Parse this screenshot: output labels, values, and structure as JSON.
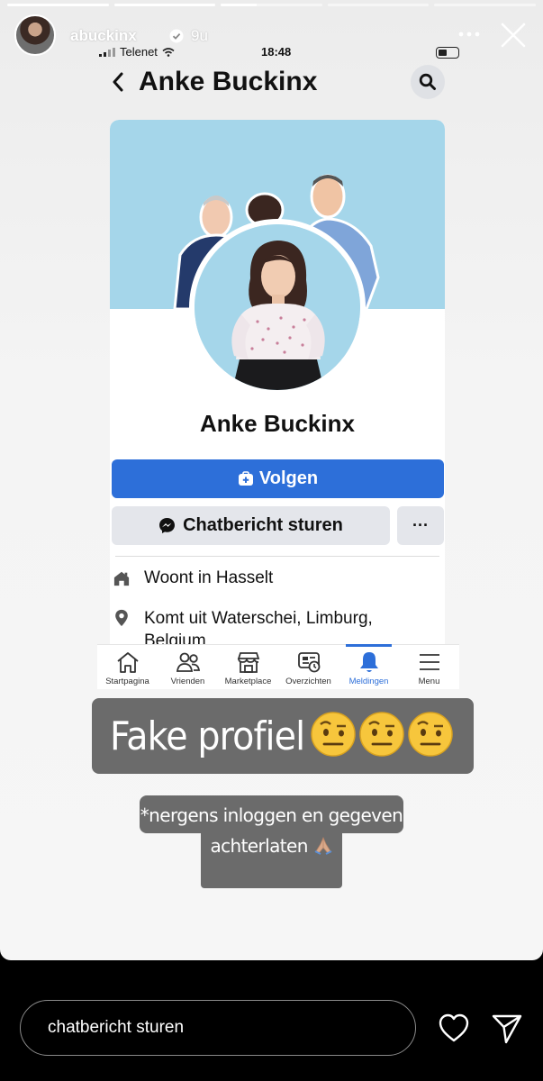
{
  "story": {
    "username": "abuckinx",
    "time_ago": "9u",
    "progress": [
      1,
      1,
      0.35,
      0,
      0
    ]
  },
  "phone_status": {
    "carrier": "Telenet",
    "time": "18:48"
  },
  "fb_profile": {
    "header_title": "Anke Buckinx",
    "name": "Anke Buckinx",
    "follow_label": "Volgen",
    "message_label": "Chatbericht sturen",
    "more_label": "···",
    "lives_in_prefix": "Woont in ",
    "lives_in_city": "Hasselt",
    "from_prefix": "Komt uit ",
    "from_place": "Waterschei, Limburg, Belgium"
  },
  "fb_nav": {
    "items": [
      {
        "label": "Startpagina",
        "icon": "home-icon"
      },
      {
        "label": "Vrienden",
        "icon": "friends-icon"
      },
      {
        "label": "Marketplace",
        "icon": "marketplace-icon"
      },
      {
        "label": "Overzichten",
        "icon": "feeds-icon"
      },
      {
        "label": "Meldingen",
        "icon": "bell-icon",
        "active": true
      },
      {
        "label": "Menu",
        "icon": "menu-icon"
      }
    ]
  },
  "stickers": {
    "fake_text": "Fake profiel",
    "caption_line1": "*nergens inloggen en gegeven",
    "caption_line2": "achterlaten",
    "emoji": "raised-eyebrow-emoji",
    "caption_emoji": "folded-hands-emoji"
  },
  "reply": {
    "placeholder": "chatbericht sturen"
  },
  "colors": {
    "fb_blue": "#2d6fd9",
    "cover_blue": "#a5d6ea",
    "sticker_gray": "#6b6b6b"
  }
}
